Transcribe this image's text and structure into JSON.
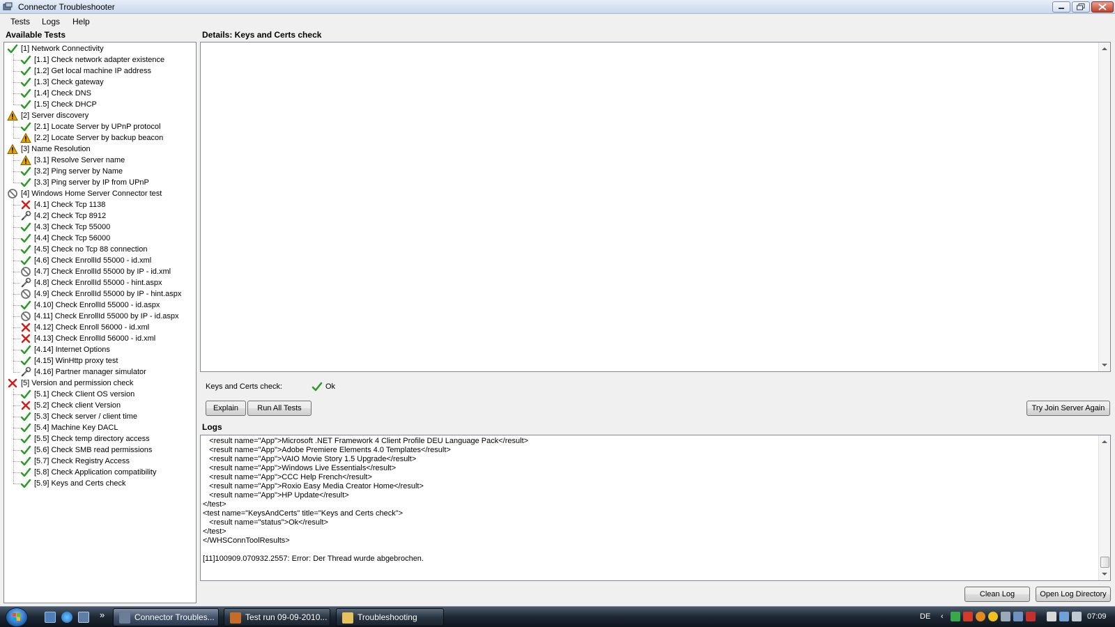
{
  "window": {
    "title": "Connector Troubleshooter"
  },
  "menu": [
    "Tests",
    "Logs",
    "Help"
  ],
  "left_panel": {
    "header": "Available Tests"
  },
  "tree": [
    {
      "label": "[1] Network Connectivity",
      "level": 0,
      "status": "ok"
    },
    {
      "label": "[1.1] Check network adapter existence",
      "level": 1,
      "status": "ok"
    },
    {
      "label": "[1.2] Get local machine IP address",
      "level": 1,
      "status": "ok"
    },
    {
      "label": "[1.3] Check gateway",
      "level": 1,
      "status": "ok"
    },
    {
      "label": "[1.4] Check DNS",
      "level": 1,
      "status": "ok"
    },
    {
      "label": "[1.5] Check DHCP",
      "level": 1,
      "status": "ok"
    },
    {
      "label": "[2] Server discovery",
      "level": 0,
      "status": "warning"
    },
    {
      "label": "[2.1] Locate Server by UPnP protocol",
      "level": 1,
      "status": "ok"
    },
    {
      "label": "[2.2] Locate Server by backup beacon",
      "level": 1,
      "status": "warning"
    },
    {
      "label": "[3] Name Resolution",
      "level": 0,
      "status": "warning"
    },
    {
      "label": "[3.1] Resolve Server name",
      "level": 1,
      "status": "warning"
    },
    {
      "label": "[3.2] Ping server by Name",
      "level": 1,
      "status": "ok"
    },
    {
      "label": "[3.3] Ping server by IP from UPnP",
      "level": 1,
      "status": "ok"
    },
    {
      "label": "[4] Windows Home Server Connector test",
      "level": 0,
      "status": "skipped"
    },
    {
      "label": "[4.1] Check Tcp 1138",
      "level": 1,
      "status": "error"
    },
    {
      "label": "[4.2] Check Tcp 8912",
      "level": 1,
      "status": "tool"
    },
    {
      "label": "[4.3] Check Tcp 55000",
      "level": 1,
      "status": "ok"
    },
    {
      "label": "[4.4] Check Tcp 56000",
      "level": 1,
      "status": "ok"
    },
    {
      "label": "[4.5] Check no Tcp 88 connection",
      "level": 1,
      "status": "ok"
    },
    {
      "label": "[4.6] Check EnrollId 55000 - id.xml",
      "level": 1,
      "status": "ok"
    },
    {
      "label": "[4.7] Check EnrollId 55000 by IP - id.xml",
      "level": 1,
      "status": "skipped"
    },
    {
      "label": "[4.8] Check EnrollId 55000 - hint.aspx",
      "level": 1,
      "status": "tool"
    },
    {
      "label": "[4.9] Check EnrollId 55000 by IP - hint.aspx",
      "level": 1,
      "status": "skipped"
    },
    {
      "label": "[4.10] Check EnrollId 55000 - id.aspx",
      "level": 1,
      "status": "ok"
    },
    {
      "label": "[4.11] Check EnrollId 55000 by IP - id.aspx",
      "level": 1,
      "status": "skipped"
    },
    {
      "label": "[4.12] Check Enroll 56000 - id.xml",
      "level": 1,
      "status": "error"
    },
    {
      "label": "[4.13] Check EnrollId 56000 - id.xml",
      "level": 1,
      "status": "error"
    },
    {
      "label": "[4.14] Internet Options",
      "level": 1,
      "status": "ok"
    },
    {
      "label": "[4.15] WinHttp proxy test",
      "level": 1,
      "status": "ok"
    },
    {
      "label": "[4.16] Partner manager simulator",
      "level": 1,
      "status": "tool"
    },
    {
      "label": "[5] Version and permission check",
      "level": 0,
      "status": "error"
    },
    {
      "label": "[5.1] Check Client OS version",
      "level": 1,
      "status": "ok"
    },
    {
      "label": "[5.2] Check client Version",
      "level": 1,
      "status": "error"
    },
    {
      "label": "[5.3] Check server / client time",
      "level": 1,
      "status": "ok"
    },
    {
      "label": "[5.4] Machine Key DACL",
      "level": 1,
      "status": "ok"
    },
    {
      "label": "[5.5] Check temp directory access",
      "level": 1,
      "status": "ok"
    },
    {
      "label": "[5.6] Check SMB read permissions",
      "level": 1,
      "status": "ok"
    },
    {
      "label": "[5.7] Check Registry Access",
      "level": 1,
      "status": "ok"
    },
    {
      "label": "[5.8] Check Application compatibility",
      "level": 1,
      "status": "ok"
    },
    {
      "label": "[5.9] Keys and Certs check",
      "level": 1,
      "status": "ok"
    }
  ],
  "details": {
    "header": "Details: Keys and Certs check"
  },
  "status": {
    "label": "Keys and Certs check:",
    "value": "Ok"
  },
  "buttons": {
    "explain": "Explain",
    "run_all": "Run All Tests",
    "try_join": "Try Join Server Again",
    "clean_log": "Clean Log",
    "open_log_dir": "Open Log Directory"
  },
  "logs": {
    "header": "Logs",
    "lines": [
      "   <result name=\"App\">Microsoft .NET Framework 4 Client Profile DEU Language Pack</result>",
      "   <result name=\"App\">Adobe Premiere Elements 4.0 Templates</result>",
      "   <result name=\"App\">VAIO Movie Story 1.5 Upgrade</result>",
      "   <result name=\"App\">Windows Live Essentials</result>",
      "   <result name=\"App\">CCC Help French</result>",
      "   <result name=\"App\">Roxio Easy Media Creator Home</result>",
      "   <result name=\"App\">HP Update</result>",
      "</test>",
      "<test name=\"KeysAndCerts\" title=\"Keys and Certs check\">",
      "   <result name=\"status\">Ok</result>",
      "</test>",
      "</WHSConnToolResults>",
      "",
      "[11]100909.070932.2557: Error: Der Thread wurde abgebrochen."
    ]
  },
  "taskbar": {
    "tasks": [
      {
        "label": "Connector Troubles...",
        "active": true
      },
      {
        "label": "Test run 09-09-2010...",
        "active": false
      },
      {
        "label": "Troubleshooting",
        "active": false
      }
    ],
    "language": "DE",
    "time": "07:09"
  },
  "colors": {
    "ok": "#2e9a2e",
    "error": "#cc1f1f",
    "warning": "#e3a400",
    "skipped": "#707070"
  },
  "icon_names": {
    "ok": "check-icon",
    "error": "error-x-icon",
    "warning": "warning-icon",
    "skipped": "skipped-icon",
    "tool": "tool-icon"
  }
}
